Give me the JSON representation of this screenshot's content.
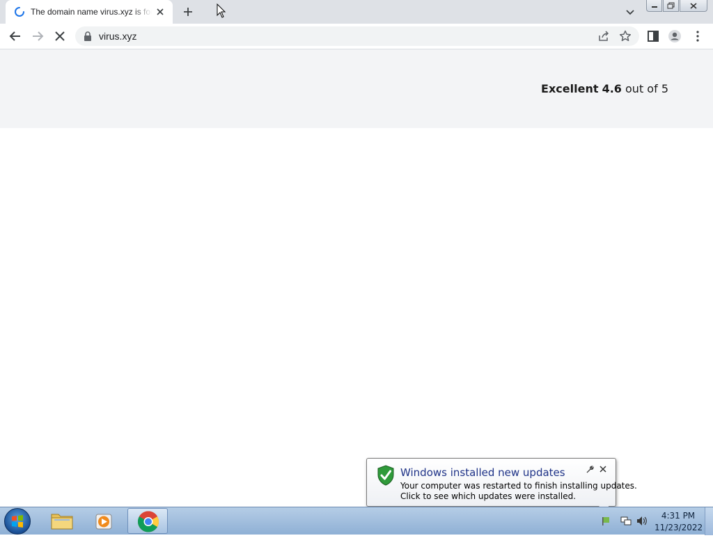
{
  "browser": {
    "tab": {
      "title": "The domain name virus.xyz is for sale",
      "loading": true
    },
    "url": "virus.xyz",
    "icons": {
      "tab_spinner": "loading-spinner-icon",
      "tab_close": "close-icon",
      "new_tab": "plus-icon",
      "tab_search": "chevron-down-icon",
      "back": "arrow-left-icon",
      "forward": "arrow-right-icon",
      "stop": "x-icon",
      "lock": "lock-icon",
      "share": "share-icon",
      "bookmark": "star-icon",
      "side_panel": "side-panel-icon",
      "profile": "person-icon",
      "menu": "kebab-menu-icon"
    }
  },
  "page": {
    "rating": {
      "label": "Excellent",
      "score": "4.6",
      "suffix": "out of 5"
    }
  },
  "notification": {
    "title": "Windows installed new updates",
    "line1": "Your computer was restarted to finish installing updates.",
    "line2": "Click to see which updates were installed."
  },
  "taskbar": {
    "apps": [
      {
        "name": "Windows Explorer",
        "icon": "folder-icon"
      },
      {
        "name": "Windows Media Player",
        "icon": "media-player-icon"
      },
      {
        "name": "Google Chrome",
        "icon": "chrome-icon",
        "active": true
      }
    ],
    "clock": {
      "time": "4:31 PM",
      "date": "11/23/2022"
    }
  },
  "colors": {
    "tabstrip": "#dee1e6",
    "page_band": "#f3f4f6",
    "balloon_title": "#1e3287",
    "taskbar": "#a7c2e3"
  }
}
